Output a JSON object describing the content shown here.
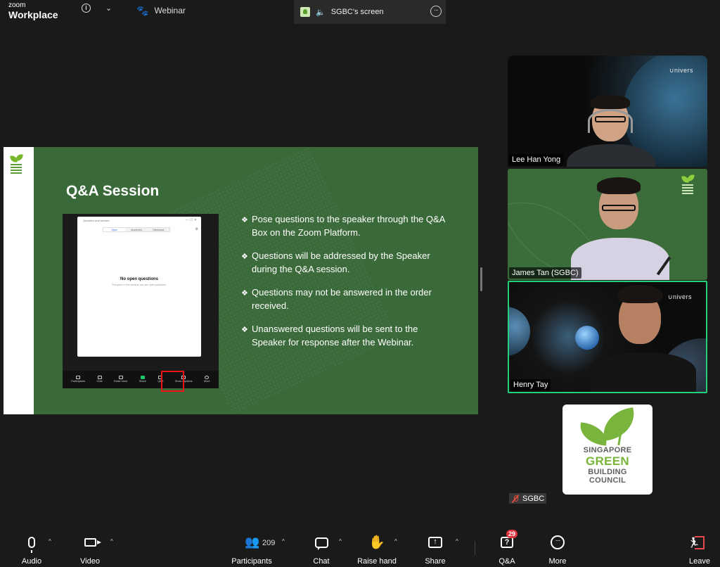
{
  "app": {
    "brand_top": "zoom",
    "brand_bottom": "Workplace"
  },
  "tabs": {
    "webinar": "Webinar",
    "screen_share": "SGBC's screen"
  },
  "slide": {
    "title": "Q&A Session",
    "bullets": [
      "Pose questions to the speaker through the Q&A Box on the Zoom Platform.",
      "Questions will be addressed by the Speaker during the Q&A session.",
      "Questions may not be answered in the order received.",
      "Unanswered questions will be sent to the Speaker for response after the Webinar."
    ],
    "bullet_symbol": "❖",
    "embedded": {
      "dialog_title": "Question and answer",
      "tabs": [
        "Open",
        "Answered",
        "Dismissed"
      ],
      "empty_title": "No open questions",
      "empty_sub": "Everyone in this webinar can see open questions.",
      "toolbar": [
        "Participants",
        "Chat",
        "Raise hand",
        "Share",
        "Q&A",
        "Show captions",
        "More"
      ]
    }
  },
  "videos": [
    {
      "name": "Lee Han Yong",
      "watermark": "∪nivers"
    },
    {
      "name": "James Tan (SGBC)"
    },
    {
      "name": "Henry Tay",
      "watermark": "∪nivers",
      "active_speaker": true
    }
  ],
  "sgbc_tile": {
    "name": "SGBC",
    "logo_lines": [
      "SINGAPORE",
      "GREEN",
      "BUILDING",
      "COUNCIL"
    ],
    "muted": true
  },
  "toolbar": {
    "audio": "Audio",
    "video": "Video",
    "participants": "Participants",
    "participants_count": "209",
    "chat": "Chat",
    "raise_hand": "Raise hand",
    "share": "Share",
    "qa": "Q&A",
    "qa_badge": "29",
    "more": "More",
    "leave": "Leave"
  },
  "colors": {
    "accent_green": "#23d17a",
    "leave_red": "#e5484d",
    "badge_red": "#e0323c",
    "slide_green": "#3b6a3a"
  }
}
